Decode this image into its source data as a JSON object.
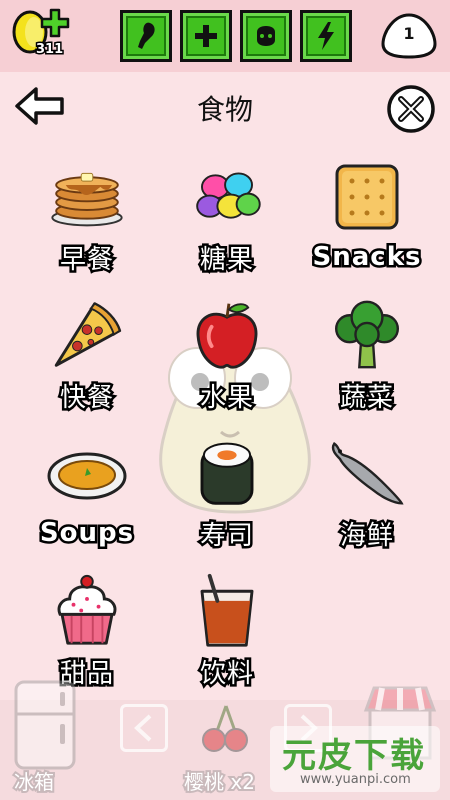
{
  "hud": {
    "coins": "311",
    "level": "1",
    "stats": [
      {
        "name": "food",
        "icon": "drumstick-icon"
      },
      {
        "name": "health",
        "icon": "plus-icon"
      },
      {
        "name": "hygiene",
        "icon": "soap-icon"
      },
      {
        "name": "energy",
        "icon": "lightning-icon"
      }
    ]
  },
  "header": {
    "title": "食物"
  },
  "categories": [
    {
      "label": "早餐",
      "icon": "pancakes-icon"
    },
    {
      "label": "糖果",
      "icon": "candy-icon"
    },
    {
      "label": "Snacks",
      "icon": "cracker-icon"
    },
    {
      "label": "快餐",
      "icon": "pizza-icon"
    },
    {
      "label": "水果",
      "icon": "apple-icon"
    },
    {
      "label": "蔬菜",
      "icon": "broccoli-icon"
    },
    {
      "label": "Soups",
      "icon": "soup-icon"
    },
    {
      "label": "寿司",
      "icon": "sushi-icon"
    },
    {
      "label": "海鲜",
      "icon": "fish-icon"
    },
    {
      "label": "甜品",
      "icon": "cupcake-icon"
    },
    {
      "label": "饮料",
      "icon": "drink-icon"
    }
  ],
  "bottom": {
    "fridge_label": "冰箱",
    "selected_item": "樱桃 x2"
  },
  "watermark": {
    "title": "元皮下载",
    "url": "www.yuanpi.com"
  },
  "colors": {
    "background": "#fbe3e6",
    "topbar": "#f6cfd4",
    "stat_green": "#41c11f"
  }
}
